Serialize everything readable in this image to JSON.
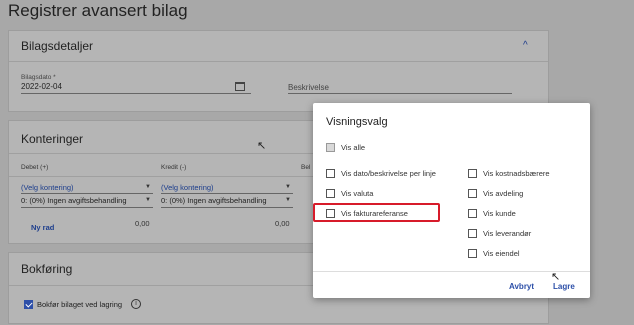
{
  "page": {
    "title": "Registrer avansert bilag"
  },
  "bilagsdetaljer": {
    "title": "Bilagsdetaljer",
    "date_label": "Bilagsdato *",
    "date_value": "2022-02-04",
    "description_label": "Beskrivelse"
  },
  "konteringer": {
    "title": "Konteringer",
    "col_debet": "Debet (+)",
    "col_kredit": "Kredit (-)",
    "col_partial": "Bel",
    "debet_select": "(Velg kontering)",
    "kredit_select": "(Velg kontering)",
    "debet_tax": "0: (0%) Ingen avgiftsbehandling",
    "kredit_tax": "0: (0%) Ingen avgiftsbehandling",
    "new_row": "Ny rad",
    "debet_amount": "0,00",
    "kredit_amount": "0,00"
  },
  "bokforing": {
    "title": "Bokføring",
    "checkbox_label": "Bokfør bilaget ved lagring",
    "checked": true
  },
  "dialog": {
    "title": "Visningsvalg",
    "show_all": "Vis alle",
    "left_options": [
      "Vis dato/beskrivelse per linje",
      "Vis valuta",
      "Vis fakturareferanse"
    ],
    "right_options": [
      "Vis kostnadsbærere",
      "Vis avdeling",
      "Vis kunde",
      "Vis leverandør",
      "Vis eiendel"
    ],
    "cancel": "Avbryt",
    "save": "Lagre"
  },
  "colors": {
    "accent": "#2c4fa8",
    "highlight": "#d71b2a"
  },
  "icons": [
    "calendar-icon",
    "chevron-up-icon",
    "dropdown-arrow-icon",
    "info-icon",
    "mouse-cursor-icon"
  ]
}
